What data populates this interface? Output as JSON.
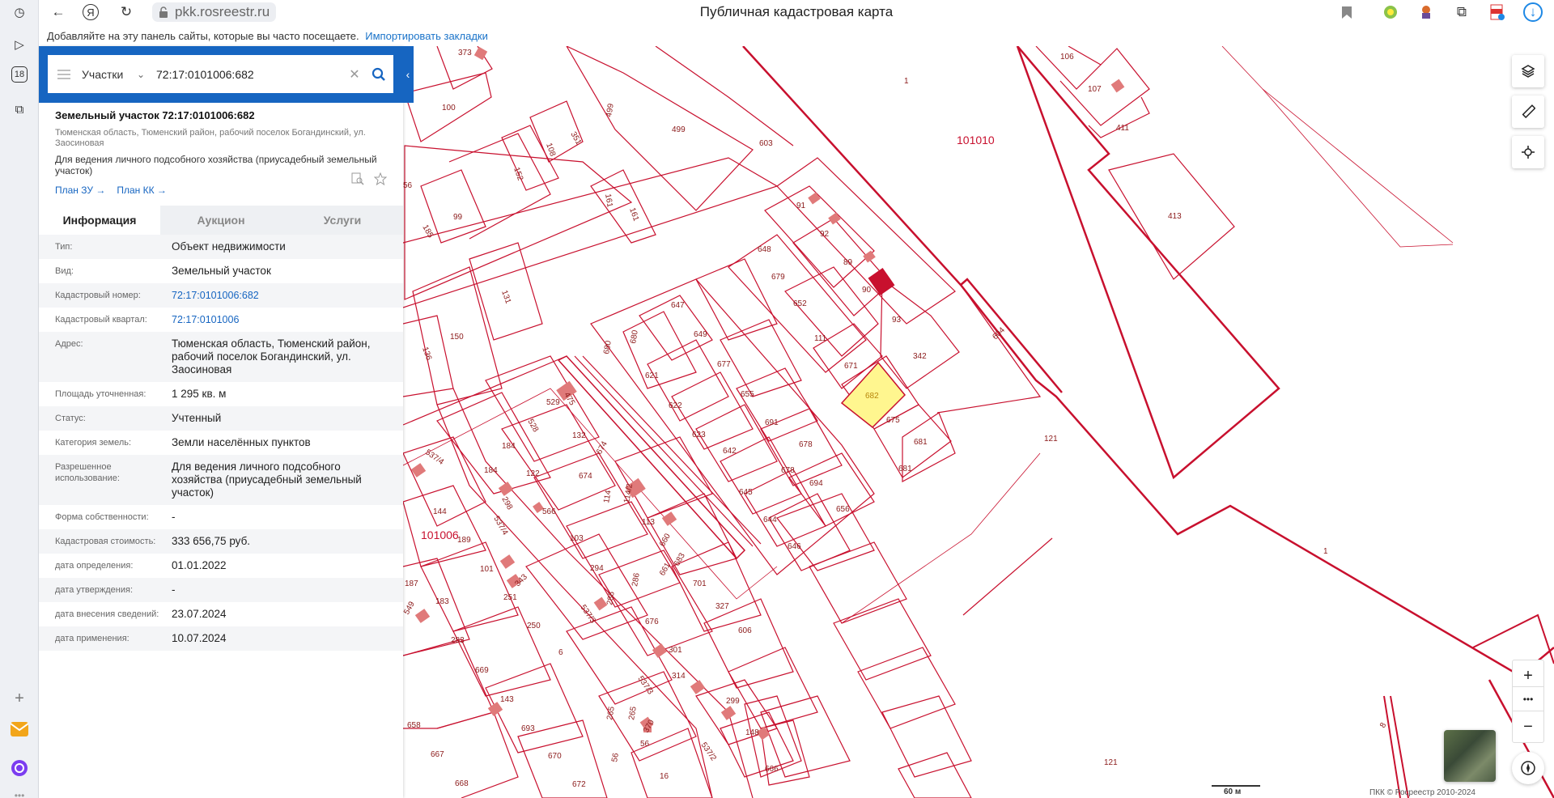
{
  "browser": {
    "url": "pkk.rosreestr.ru",
    "page_title": "Публичная кадастровая карта",
    "bookmarks_hint": "Добавляйте на эту панель сайты, которые вы часто посещаете.",
    "bookmarks_import": "Импортировать закладки",
    "rail_badge": "18"
  },
  "search": {
    "type": "Участки",
    "query": "72:17:0101006:682"
  },
  "object": {
    "title": "Земельный участок 72:17:0101006:682",
    "address": "Тюменская область, Тюменский район, рабочий поселок Богандинский, ул. Заосиновая",
    "use": "Для ведения личного подсобного хозяйства (приусадебный земельный участок)",
    "link_plan_zu": "План ЗУ →",
    "link_plan_kk": "План КК →"
  },
  "tabs": [
    "Информация",
    "Аукцион",
    "Услуги"
  ],
  "info_rows": [
    {
      "key": "Тип:",
      "value": "Объект недвижимости"
    },
    {
      "key": "Вид:",
      "value": "Земельный участок"
    },
    {
      "key": "Кадастровый номер:",
      "value": "72:17:0101006:682",
      "link": true
    },
    {
      "key": "Кадастровый квартал:",
      "value": "72:17:0101006",
      "link": true
    },
    {
      "key": "Адрес:",
      "value": "Тюменская область, Тюменский район, рабочий поселок Богандинский, ул. Заосиновая"
    },
    {
      "key": "Площадь уточненная:",
      "value": "1 295 кв. м"
    },
    {
      "key": "Статус:",
      "value": "Учтенный"
    },
    {
      "key": "Категория земель:",
      "value": "Земли населённых пунктов"
    },
    {
      "key": "Разрешенное использование:",
      "value": "Для ведения личного подсобного хозяйства (приусадебный земельный участок)"
    },
    {
      "key": "Форма собственности:",
      "value": "-"
    },
    {
      "key": "Кадастровая стоимость:",
      "value": "333 656,75 руб."
    },
    {
      "key": "дата определения:",
      "value": "01.01.2022"
    },
    {
      "key": "дата утверждения:",
      "value": "-"
    },
    {
      "key": "дата внесения сведений:",
      "value": "23.07.2024"
    },
    {
      "key": "дата применения:",
      "value": "10.07.2024"
    }
  ],
  "map": {
    "scale_label": "60 м",
    "copyright": "ПКК © Росреестр 2010-2024",
    "quarter_labels": [
      "101010",
      "101006"
    ],
    "selected_parcel": "682",
    "parcel_labels": [
      "373",
      "100",
      "351",
      "108",
      "152",
      "499",
      "499",
      "603",
      "1",
      "106",
      "107",
      "411",
      "101010",
      "413",
      "161",
      "161",
      "99",
      "185",
      "56",
      "131",
      "150",
      "136",
      "91",
      "92",
      "89",
      "90",
      "648",
      "679",
      "652",
      "93",
      "342",
      "604",
      "647",
      "649",
      "680",
      "680",
      "621",
      "677",
      "622",
      "655",
      "111",
      "671",
      "682",
      "675",
      "681",
      "681",
      "529",
      "528",
      "132",
      "674",
      "623",
      "642",
      "691",
      "678",
      "678",
      "694",
      "645",
      "656",
      "644",
      "646",
      "184",
      "184",
      "122",
      "298",
      "566",
      "674",
      "114",
      "114/2",
      "113",
      "103",
      "294",
      "660",
      "661",
      "683",
      "701",
      "327",
      "606",
      "121",
      "121",
      "1",
      "144",
      "101006",
      "189",
      "187",
      "101",
      "251",
      "343",
      "183",
      "283",
      "250",
      "6",
      "669",
      "286",
      "676",
      "301",
      "314",
      "299",
      "148",
      "666",
      "143",
      "693",
      "265",
      "265",
      "370",
      "56",
      "670",
      "16",
      "672",
      "658",
      "667",
      "668",
      "537/4",
      "537/4",
      "537/3",
      "537/3",
      "537/2",
      "56"
    ]
  },
  "colors": {
    "brand": "#1665c1",
    "parcel_line": "#c8102e",
    "selected_fill": "#fff68f",
    "building": "#e07a7a"
  }
}
